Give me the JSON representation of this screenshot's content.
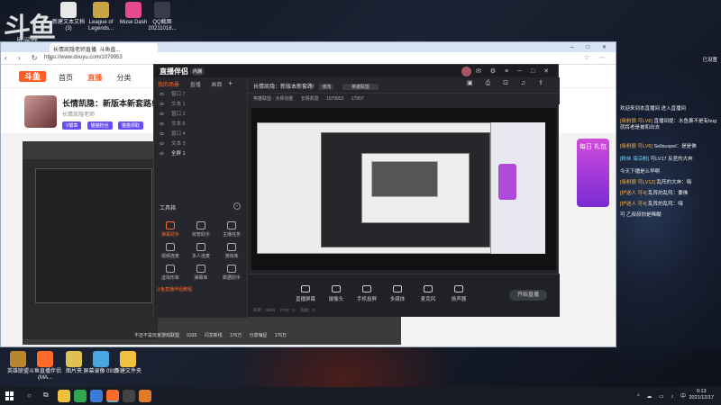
{
  "desktop": {
    "watermark": "斗鱼",
    "watermark_sub": "展阅群",
    "icons_top": [
      {
        "label": "新建文本文档 (3)"
      },
      {
        "label": "League of Legends..."
      },
      {
        "label": "Muse Dash"
      },
      {
        "label": "QQ截图 20211018..."
      }
    ],
    "icons_bottom": [
      {
        "label": "英雄联盟"
      },
      {
        "label": "斗鱼直播伴侣(MA..."
      },
      {
        "label": "图片夹"
      },
      {
        "label": "屏幕录像 0910"
      },
      {
        "label": "新建文件夹"
      }
    ]
  },
  "browser": {
    "tab_title": "长情凯隐老师直播_斗鱼直...",
    "url": "https://www.douyu.com/1079953",
    "site_logo": "斗鱼",
    "nav": [
      "首页",
      "直播",
      "分类"
    ],
    "streamer_title": "长情凯隐：新版本新套路!",
    "streamer_meta": "长情凯隐老师",
    "streamer_badges": [
      "V徽章",
      "猫猫粉丝",
      "猫猫领取"
    ],
    "video_bottom_labels": [
      "不还不是玩家游戏联盟",
      "5335",
      "闪龙新线",
      "176万",
      "分享嗨星",
      "176万"
    ]
  },
  "chat": {
    "header_right": "已设置",
    "lines": [
      {
        "user": "",
        "text": "欢迎来到本直播间  进入直播间"
      },
      {
        "user": "[吸粉狼 可LV6]",
        "text": "直播间提：水鱼暴不是有bug就挥老是被和出去"
      },
      {
        "user": "[吸粉狼 可LV6]",
        "text": "Sellsuspel：是是佛"
      },
      {
        "user": "[粉丝 海沿粉]",
        "text": "可LV17 反差的大奔"
      },
      {
        "user": "",
        "text": "今天下播是么早啊"
      },
      {
        "user": "[吸粉狼 可LV12]",
        "text": "乱阵的大奔：嗨"
      },
      {
        "user": "[护送人 可4]",
        "text": "乱阵的乱阵：要佛"
      },
      {
        "user": "[护送人 可4]",
        "text": "乱阵的乱阵：嗨"
      },
      {
        "user": "",
        "text": "可 乙叔叔你是稀糊"
      }
    ],
    "gift_text": "每日 礼包"
  },
  "app": {
    "title": "直播伴侣",
    "badge": "内测",
    "scene_tabs": [
      "我的场景",
      "直播",
      "画面"
    ],
    "scenes": [
      "窗口 7",
      "文本 1",
      "窗口 1",
      "文本 5",
      "窗口 4",
      "文本 3",
      "全屏 1"
    ],
    "tools_title": "工具箱",
    "tools": [
      {
        "label": "弹幕助手"
      },
      {
        "label": "房管助手"
      },
      {
        "label": "主播任务"
      },
      {
        "label": "视频连麦"
      },
      {
        "label": "多人连麦"
      },
      {
        "label": "游戏库"
      },
      {
        "label": "虚拟形象"
      },
      {
        "label": "弹幕库"
      },
      {
        "label": "数据助手"
      },
      {
        "label": "斗鱼直播伴侣教程"
      }
    ],
    "live_title": "长情凯隐：新版本新套路!",
    "live_tag": "修改",
    "live_category": "英雄联盟",
    "live_subline": [
      "英雄联盟 - 大师剑胜",
      "长情凯隐",
      "1079953",
      "17907"
    ],
    "bottom_buttons": [
      {
        "label": "直播屏幕"
      },
      {
        "label": "摄像头"
      },
      {
        "label": "手机投屏"
      },
      {
        "label": "多媒体"
      },
      {
        "label": "麦克风"
      },
      {
        "label": "扬声器"
      }
    ],
    "start_label": "开始直播",
    "status": [
      "码率：0kb/s",
      "FPS：0",
      "丢帧：0"
    ]
  },
  "taskbar": {
    "time": "0:13",
    "date": "2021/12/17"
  }
}
